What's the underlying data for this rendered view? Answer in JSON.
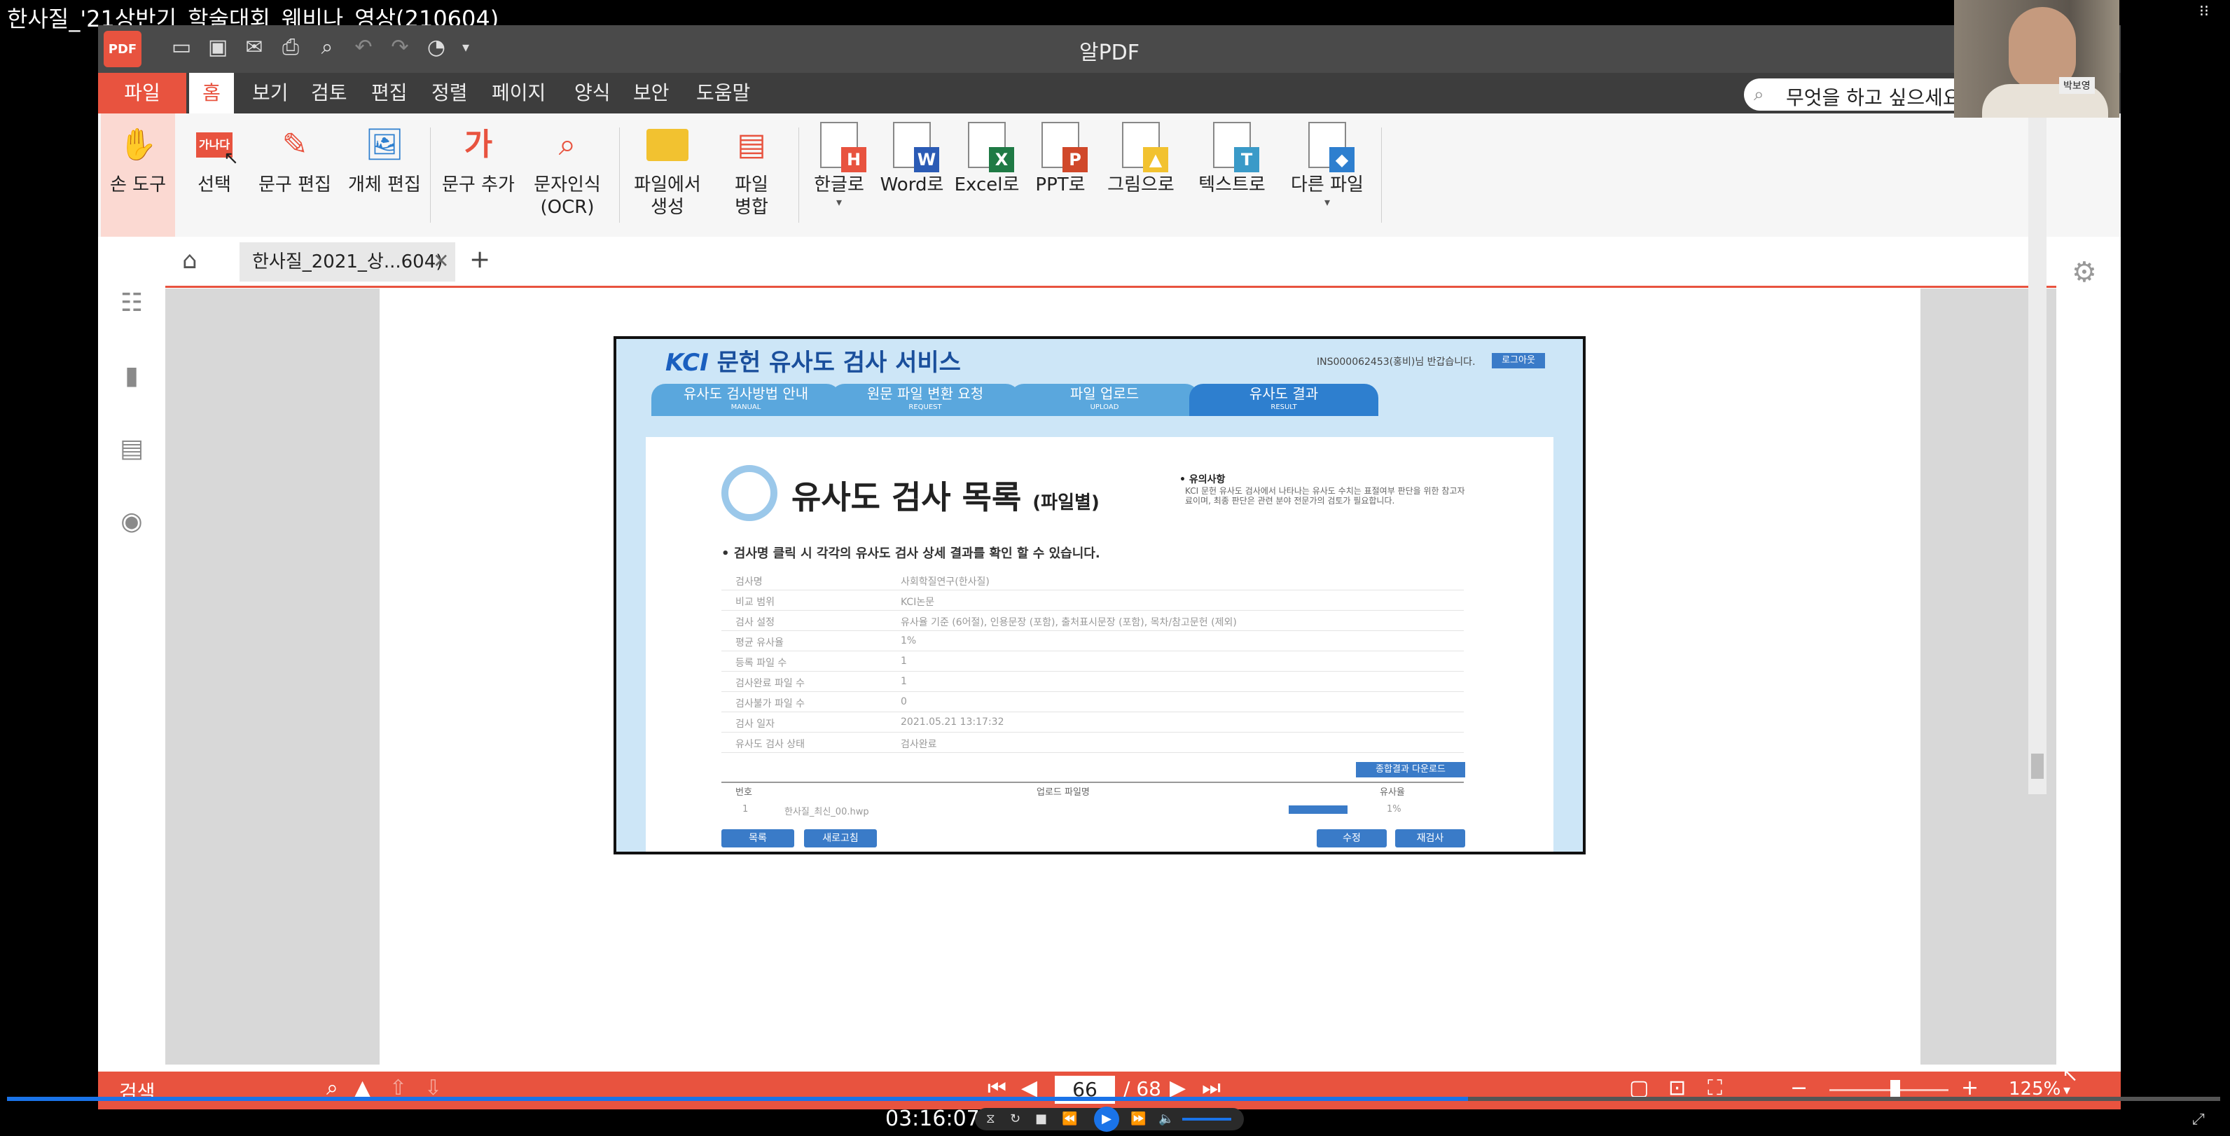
{
  "video": {
    "title": "한사질_'21상반기_학술대회_웨비나_영상(210604)",
    "time": "03:16:07",
    "progress_pct": 66
  },
  "app": {
    "name": "알PDF",
    "logo": "PDF",
    "search_placeholder": "무엇을 하고 싶으세요?",
    "webcam_name_tag": "박보영"
  },
  "menu": [
    "파일",
    "홈",
    "보기",
    "검토",
    "편집",
    "정렬",
    "페이지",
    "양식",
    "보안",
    "도움말"
  ],
  "ribbon": {
    "hand": "손 도구",
    "select": "선택",
    "select_badge": "가나다",
    "text_edit": "문구 편집",
    "object_edit": "개체 편집",
    "add_text": "문구 추가",
    "add_text_glyph": "가",
    "ocr_1": "문자인식",
    "ocr_2": "(OCR)",
    "from_file_1": "파일에서",
    "from_file_2": "생성",
    "merge_1": "파일",
    "merge_2": "병합",
    "to_hwp": "한글로",
    "to_word": "Word로",
    "to_excel": "Excel로",
    "to_ppt": "PPT로",
    "to_image": "그림으로",
    "to_text": "텍스트로",
    "to_other": "다른 파일",
    "badge_h": "H",
    "badge_w": "W",
    "badge_x": "X",
    "badge_p": "P",
    "badge_t": "T"
  },
  "tabs": {
    "doc_tab": "한사질_2021_상...604)"
  },
  "page_content": {
    "kci": "KCI",
    "service_title": "문헌 유사도 검사 서비스",
    "user_text": "INS000062453(홍비)님 반갑습니다.",
    "logout": "로그아웃",
    "steps": [
      {
        "label": "유사도 검사방법 안내",
        "sub": "MANUAL"
      },
      {
        "label": "원문 파일 변환 요청",
        "sub": "REQUEST"
      },
      {
        "label": "파일 업로드",
        "sub": "UPLOAD"
      },
      {
        "label": "유사도 결과",
        "sub": "RESULT"
      }
    ],
    "heading": "유사도 검사 목록",
    "heading_sub": "(파일별)",
    "note_title": "• 유의사항",
    "note_text": "KCI 문헌 유사도 검사에서 나타나는 유사도 수치는 표절여부 판단을 위한 참고자료이며, 최종 판단은 관련 분야 전문가의 검토가 필요합니다.",
    "lead": "• 검사명 클릭 시 각각의 유사도 검사 상세 결과를 확인 할 수 있습니다.",
    "rows": [
      {
        "k": "검사명",
        "v": "사회학질연구(한사질)"
      },
      {
        "k": "비교 범위",
        "v": "KCI논문"
      },
      {
        "k": "검사 설정",
        "v": "유사율 기준 (6어절), 인용문장 (포함), 출처표시문장 (포함), 목차/참고문헌 (제외)"
      },
      {
        "k": "평균 유사율",
        "v": "1%"
      },
      {
        "k": "등록 파일 수",
        "v": "1"
      },
      {
        "k": "검사완료 파일 수",
        "v": "1"
      },
      {
        "k": "검사불가 파일 수",
        "v": "0"
      },
      {
        "k": "검사 일자",
        "v": "2021.05.21 13:17:32"
      },
      {
        "k": "유사도 검사 상태",
        "v": "검사완료"
      }
    ],
    "download_btn": "종합결과 다운로드",
    "table_no": "번호",
    "table_file": "업로드 파일명",
    "table_rate": "유사율",
    "row_no": "1",
    "row_file": "한사질_최신_00.hwp",
    "row_rate": "1%",
    "btn_list": "목록",
    "btn_refresh": "새로고침",
    "btn_edit": "수정",
    "btn_recheck": "재검사"
  },
  "status": {
    "search": "검색",
    "page": "66",
    "total": "/ 68",
    "zoom": "125%",
    "zoom_level_pct": 55
  },
  "icons": {
    "colors": {
      "accent": "#e8533f",
      "titlebar": "#4a4a4a",
      "menubar": "#3d3d3d",
      "kci_blue": "#1a5fbf"
    }
  }
}
